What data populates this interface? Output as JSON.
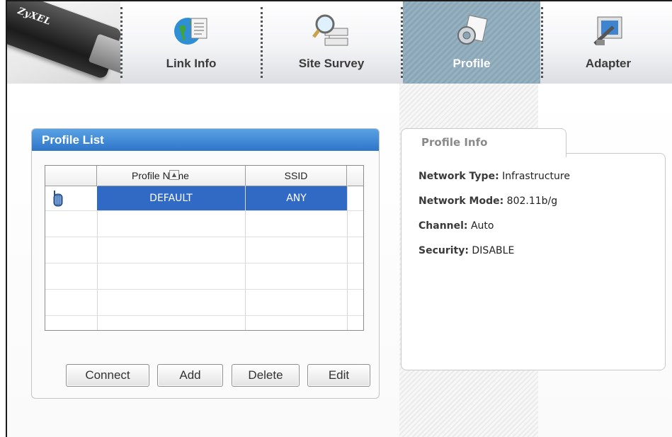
{
  "brand": {
    "logo": "ZyXEL"
  },
  "tabs": [
    {
      "label": "Link Info",
      "icon": "globe-document-icon",
      "active": false
    },
    {
      "label": "Site Survey",
      "icon": "magnifier-network-icon",
      "active": false
    },
    {
      "label": "Profile",
      "icon": "gear-document-icon",
      "active": true
    },
    {
      "label": "Adapter",
      "icon": "adapter-icon",
      "active": false
    }
  ],
  "profile_list": {
    "title": "Profile List",
    "columns": [
      "Profile Name",
      "SSID"
    ],
    "rows": [
      {
        "name": "DEFAULT",
        "ssid": "ANY",
        "selected": true,
        "icon": "infrastructure-ap-icon"
      }
    ],
    "buttons": {
      "connect": "Connect",
      "add": "Add",
      "delete": "Delete",
      "edit": "Edit"
    }
  },
  "profile_info": {
    "title": "Profile Info",
    "network_type_label": "Network Type:",
    "network_type_value": "Infrastructure",
    "network_mode_label": "Network Mode:",
    "network_mode_value": "802.11b/g",
    "channel_label": "Channel:",
    "channel_value": "Auto",
    "security_label": "Security:",
    "security_value": "DISABLE"
  },
  "colors": {
    "header_blue": "#2e75c9",
    "selection": "#316ac5",
    "active_tab": "#8aa6b6"
  }
}
